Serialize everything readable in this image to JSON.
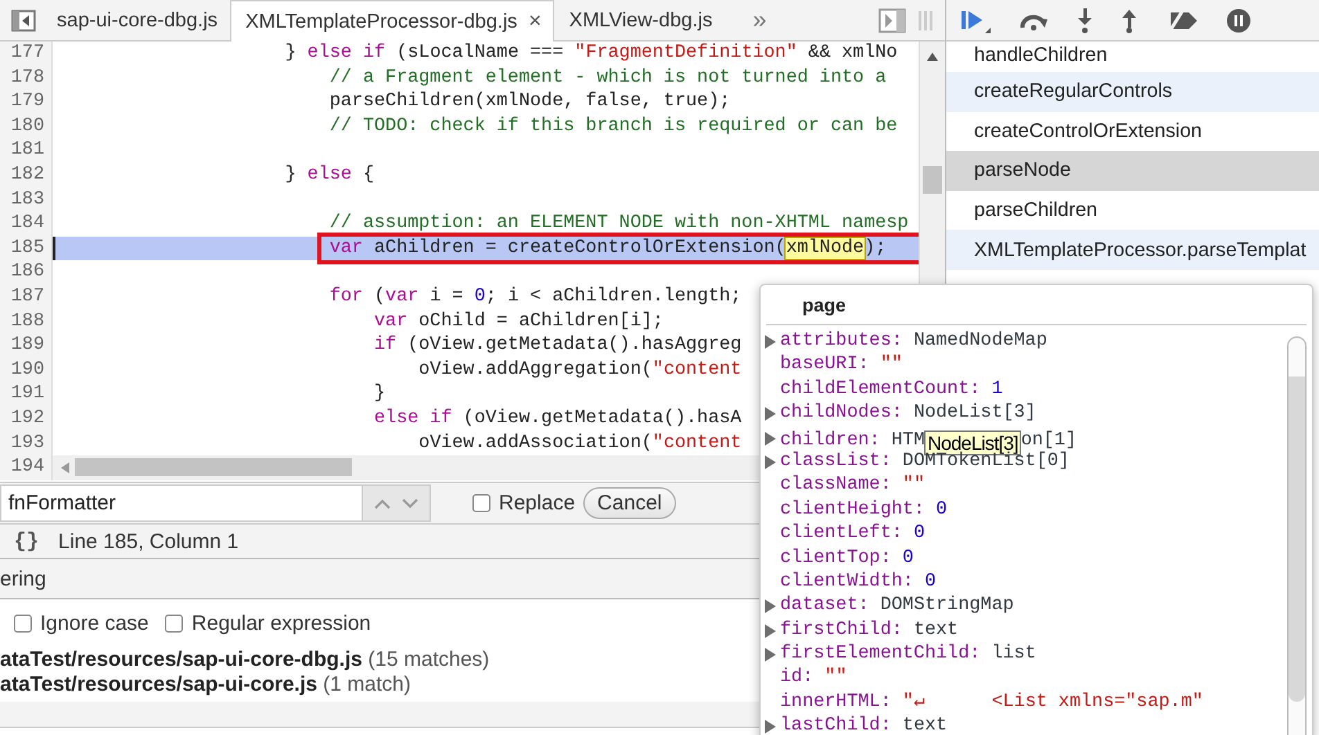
{
  "tabs": [
    {
      "label": "sap-ui-core-dbg.js",
      "selected": false
    },
    {
      "label": "XMLTemplateProcessor-dbg.js",
      "selected": true,
      "close": "×"
    },
    {
      "label": "XMLView-dbg.js",
      "selected": false
    }
  ],
  "tabs_overflow": "»",
  "code": {
    "lines": [
      {
        "number": "177",
        "current": false,
        "boxed": false,
        "segments": [
          {
            "kind": "plain",
            "text": "                    } "
          },
          {
            "kind": "kw",
            "text": "else if"
          },
          {
            "kind": "plain",
            "text": " (sLocalName === "
          },
          {
            "kind": "str",
            "text": "\"FragmentDefinition\""
          },
          {
            "kind": "plain",
            "text": " && xmlNo"
          }
        ]
      },
      {
        "number": "178",
        "current": false,
        "boxed": false,
        "segments": [
          {
            "kind": "com",
            "text": "                        // a Fragment element - which is not turned into a"
          }
        ]
      },
      {
        "number": "179",
        "current": false,
        "boxed": false,
        "segments": [
          {
            "kind": "plain",
            "text": "                        parseChildren(xmlNode, false, true);"
          }
        ]
      },
      {
        "number": "180",
        "current": false,
        "boxed": false,
        "segments": [
          {
            "kind": "com",
            "text": "                        // TODO: check if this branch is required or can be"
          }
        ]
      },
      {
        "number": "181",
        "current": false,
        "boxed": false
      },
      {
        "number": "182",
        "current": false,
        "boxed": false,
        "segments": [
          {
            "kind": "plain",
            "text": "                    } "
          },
          {
            "kind": "kw",
            "text": "else"
          },
          {
            "kind": "plain",
            "text": " {"
          }
        ]
      },
      {
        "number": "183",
        "current": false,
        "boxed": false
      },
      {
        "number": "184",
        "current": false,
        "boxed": false,
        "segments": [
          {
            "kind": "com",
            "text": "                        // assumption: an ELEMENT NODE with non-XHTML namesp"
          }
        ]
      },
      {
        "number": "185",
        "current": true,
        "boxed": true,
        "segments": [
          {
            "kind": "kw",
            "text": "                        var"
          },
          {
            "kind": "plain",
            "text": " aChildren = createControlOrExtension("
          },
          {
            "kind": "match",
            "text": "xmlNode"
          },
          {
            "kind": "plain",
            "text": ");"
          }
        ]
      },
      {
        "number": "186",
        "current": false,
        "boxed": false
      },
      {
        "number": "187",
        "current": false,
        "boxed": false,
        "segments": [
          {
            "kind": "kw",
            "text": "                        for"
          },
          {
            "kind": "plain",
            "text": " ("
          },
          {
            "kind": "kw",
            "text": "var"
          },
          {
            "kind": "plain",
            "text": " i = "
          },
          {
            "kind": "num",
            "text": "0"
          },
          {
            "kind": "plain",
            "text": "; i < aChildren.length;"
          }
        ]
      },
      {
        "number": "188",
        "current": false,
        "boxed": false,
        "segments": [
          {
            "kind": "kw",
            "text": "                            var"
          },
          {
            "kind": "plain",
            "text": " oChild = aChildren[i];"
          }
        ]
      },
      {
        "number": "189",
        "current": false,
        "boxed": false,
        "segments": [
          {
            "kind": "kw",
            "text": "                            if"
          },
          {
            "kind": "plain",
            "text": " (oView.getMetadata().hasAggreg"
          }
        ]
      },
      {
        "number": "190",
        "current": false,
        "boxed": false,
        "segments": [
          {
            "kind": "plain",
            "text": "                                oView.addAggregation("
          },
          {
            "kind": "str",
            "text": "\"content"
          }
        ]
      },
      {
        "number": "191",
        "current": false,
        "boxed": false,
        "segments": [
          {
            "kind": "plain",
            "text": "                            }"
          }
        ]
      },
      {
        "number": "192",
        "current": false,
        "boxed": false,
        "segments": [
          {
            "kind": "kw",
            "text": "                            else if"
          },
          {
            "kind": "plain",
            "text": " (oView.getMetadata().hasA"
          }
        ]
      },
      {
        "number": "193",
        "current": false,
        "boxed": false,
        "segments": [
          {
            "kind": "plain",
            "text": "                                oView.addAssociation("
          },
          {
            "kind": "str",
            "text": "\"content"
          }
        ]
      }
    ],
    "scroll_line_number": "194"
  },
  "search": {
    "value": "fnFormatter",
    "replace": {
      "label": "Replace",
      "checked": false
    },
    "cancel": "Cancel"
  },
  "status": {
    "format_button": "{}",
    "position": "Line 185, Column 1"
  },
  "drawer": {
    "title": "ering",
    "options": [
      {
        "label": "Ignore case",
        "checked": false
      },
      {
        "label": "Regular expression",
        "checked": false
      }
    ],
    "results": [
      {
        "file": "ataTest/resources/sap-ui-core-dbg.js",
        "count": "(15 matches)"
      },
      {
        "file": "ataTest/resources/sap-ui-core.js",
        "count": "(1 match)"
      }
    ]
  },
  "call_stack": [
    {
      "name": "handleChildren",
      "selected": false,
      "shaded": false
    },
    {
      "name": "createRegularControls",
      "selected": false,
      "shaded": true
    },
    {
      "name": "createControlOrExtension",
      "selected": false,
      "shaded": false
    },
    {
      "name": "parseNode",
      "selected": true,
      "shaded": false
    },
    {
      "name": "parseChildren",
      "selected": false,
      "shaded": false
    },
    {
      "name": "XMLTemplateProcessor.parseTemplat",
      "selected": false,
      "shaded": true
    }
  ],
  "popover": {
    "title": "page",
    "properties": [
      {
        "name": "attributes:",
        "value": "NamedNodeMap",
        "kind": "object",
        "expandable": true
      },
      {
        "name": "baseURI:",
        "value": "\"\"",
        "kind": "string",
        "expandable": false
      },
      {
        "name": "childElementCount:",
        "value": "1",
        "kind": "number",
        "expandable": false
      },
      {
        "name": "childNodes:",
        "value": "NodeList[3]",
        "kind": "object",
        "expandable": true
      },
      {
        "name": "children:",
        "value": "HTM",
        "tooltip": "NodeList[3]",
        "value_after": "on[1]",
        "kind": "object",
        "expandable": true
      },
      {
        "name": "classList:",
        "value": "DOMTokenList[0]",
        "kind": "object",
        "expandable": true
      },
      {
        "name": "className:",
        "value": "\"\"",
        "kind": "string",
        "expandable": false
      },
      {
        "name": "clientHeight:",
        "value": "0",
        "kind": "number",
        "expandable": false
      },
      {
        "name": "clientLeft:",
        "value": "0",
        "kind": "number",
        "expandable": false
      },
      {
        "name": "clientTop:",
        "value": "0",
        "kind": "number",
        "expandable": false
      },
      {
        "name": "clientWidth:",
        "value": "0",
        "kind": "number",
        "expandable": false
      },
      {
        "name": "dataset:",
        "value": "DOMStringMap",
        "kind": "object",
        "expandable": true
      },
      {
        "name": "firstChild:",
        "value": "text",
        "kind": "object",
        "expandable": true
      },
      {
        "name": "firstElementChild:",
        "value": "list",
        "kind": "object",
        "expandable": true
      },
      {
        "name": "id:",
        "value": "\"\"",
        "kind": "string",
        "expandable": false
      },
      {
        "name": "innerHTML:",
        "value": "\"↵      <List xmlns=\"sap.m\"",
        "kind": "string",
        "expandable": false
      },
      {
        "name": "lastChild:",
        "value": "text",
        "kind": "object",
        "expandable": true
      }
    ]
  }
}
